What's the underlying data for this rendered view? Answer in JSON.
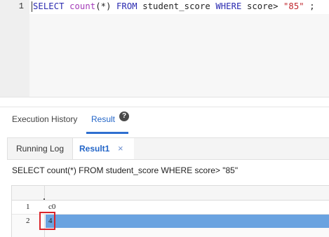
{
  "editor": {
    "line_number": "1",
    "tokens": {
      "select": "SELECT",
      "count": "count",
      "paren": "(*)",
      "from": "FROM",
      "table": "student_score",
      "where": "WHERE",
      "col": "score>",
      "value": "\"85\"",
      "semi": ";"
    }
  },
  "tabs": {
    "history": "Execution History",
    "result": "Result",
    "help_icon": "question-circle-icon"
  },
  "subtabs": {
    "running_log": "Running Log",
    "result1": "Result1",
    "close": "×"
  },
  "query_text": "SELECT count(*) FROM student_score WHERE score> \"85\"",
  "grid": {
    "rows": [
      {
        "num": "1",
        "value": "c0"
      },
      {
        "num": "2",
        "value": "4"
      }
    ]
  },
  "colors": {
    "accent": "#2f6fd0",
    "selection": "#6aa3e0",
    "highlight_box": "#d9242b"
  }
}
